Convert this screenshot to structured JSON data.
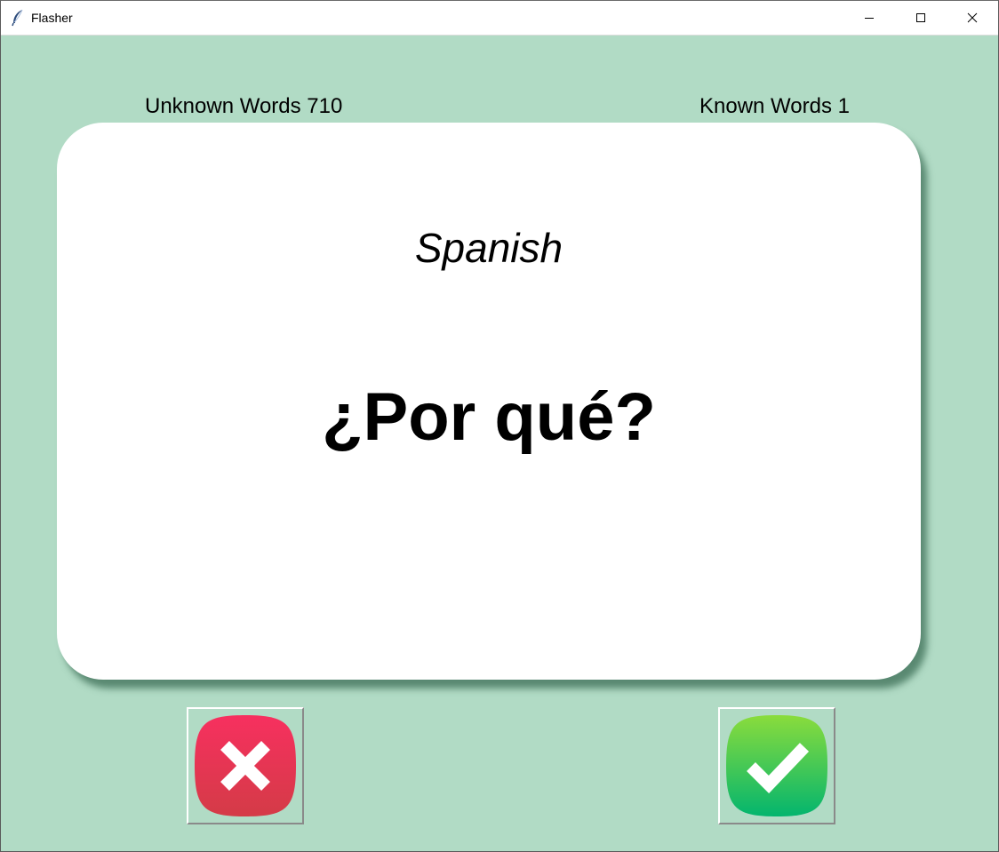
{
  "window": {
    "title": "Flasher",
    "app_icon": "feather-icon",
    "controls": [
      "minimize-icon",
      "maximize-icon",
      "close-icon"
    ]
  },
  "counters": {
    "unknown": "Unknown Words 710",
    "known": "Known Words 1"
  },
  "card": {
    "language": "Spanish",
    "word": "¿Por qué?"
  },
  "buttons": {
    "wrong": {
      "icon": "x-icon",
      "color": "#e8335a"
    },
    "right": {
      "icon": "checkmark-icon",
      "color": "#27c45a"
    }
  },
  "colors": {
    "background": "#b1dbc5",
    "card": "#ffffff"
  }
}
